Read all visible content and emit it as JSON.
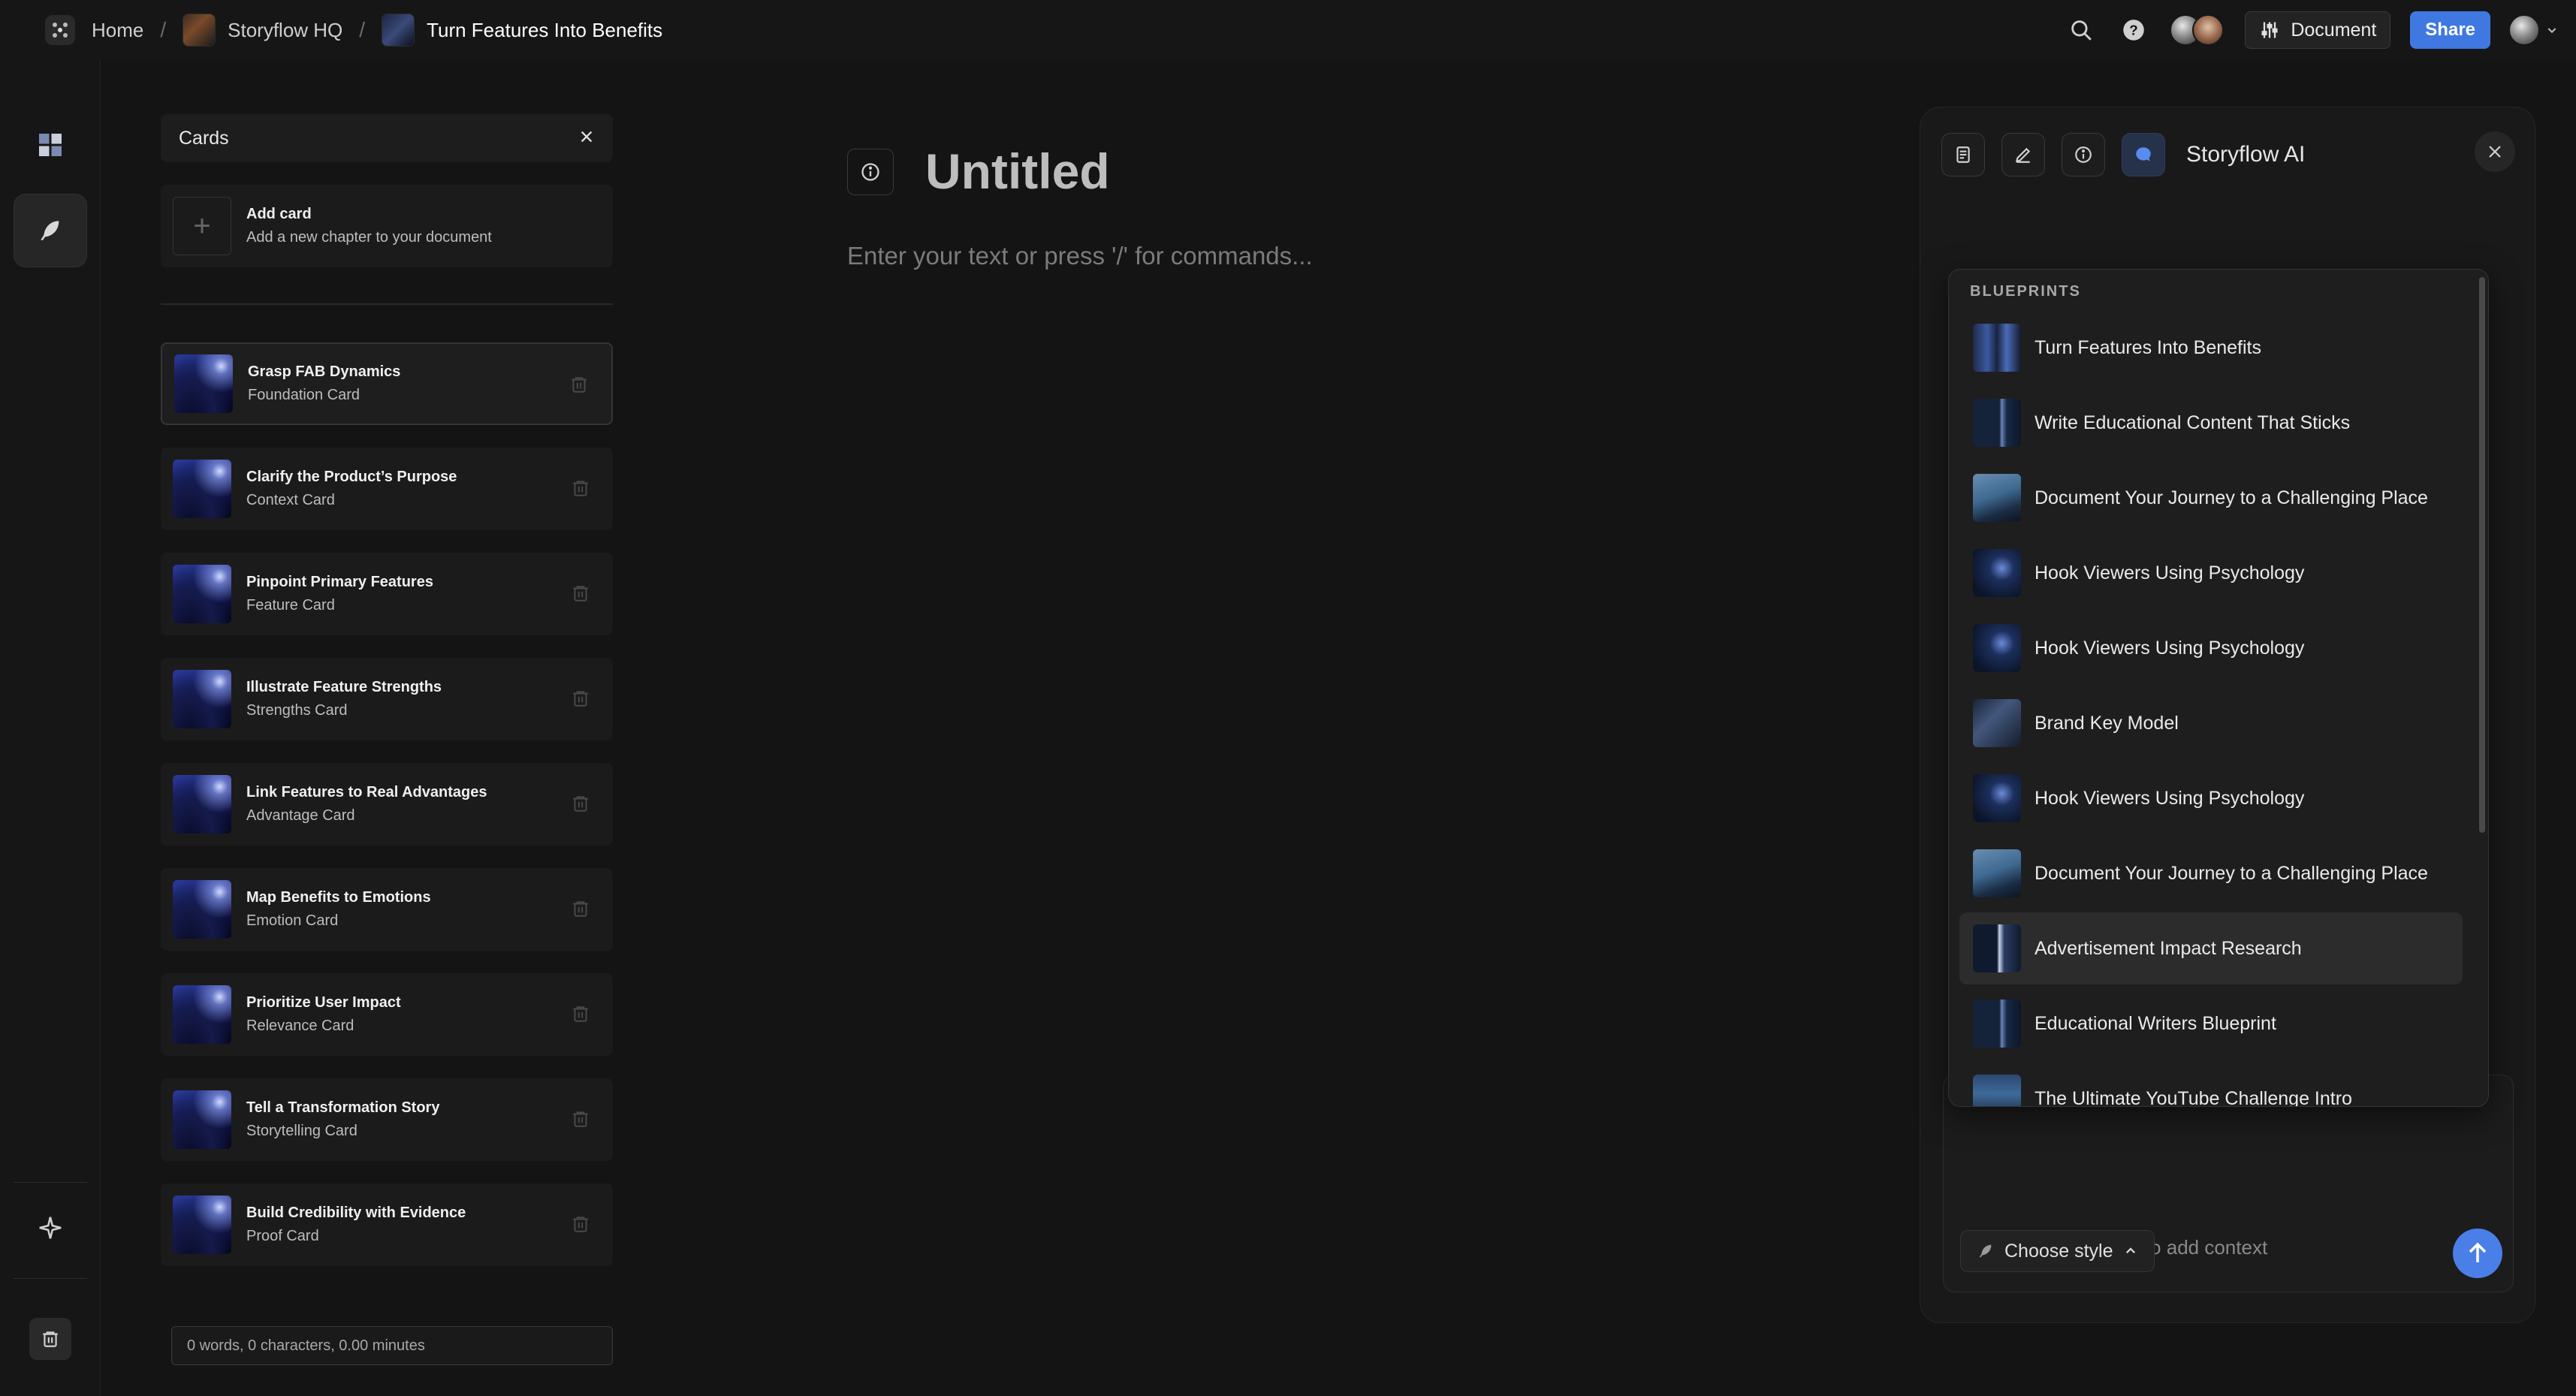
{
  "breadcrumbs": [
    {
      "label": "Home"
    },
    {
      "label": "Storyflow HQ"
    },
    {
      "label": "Turn Features Into Benefits"
    }
  ],
  "topbar": {
    "document_label": "Document",
    "share_label": "Share",
    "accent_color": "#3f78e0"
  },
  "cards_panel": {
    "title": "Cards",
    "add_card": {
      "title": "Add card",
      "subtitle": "Add a new chapter to your document"
    },
    "cards": [
      {
        "title": "Grasp FAB Dynamics",
        "subtitle": "Foundation Card"
      },
      {
        "title": "Clarify the Product’s Purpose",
        "subtitle": "Context Card"
      },
      {
        "title": "Pinpoint Primary Features",
        "subtitle": "Feature Card"
      },
      {
        "title": "Illustrate Feature Strengths",
        "subtitle": "Strengths Card"
      },
      {
        "title": "Link Features to Real Advantages",
        "subtitle": "Advantage Card"
      },
      {
        "title": "Map Benefits to Emotions",
        "subtitle": "Emotion Card"
      },
      {
        "title": "Prioritize User Impact",
        "subtitle": "Relevance Card"
      },
      {
        "title": "Tell a Transformation Story",
        "subtitle": "Storytelling Card"
      },
      {
        "title": "Build Credibility with Evidence",
        "subtitle": "Proof Card"
      }
    ],
    "stats": "0 words, 0 characters, 0.00 minutes"
  },
  "editor": {
    "title": "Untitled",
    "placeholder": "Enter your text or press '/' for commands..."
  },
  "ai_panel": {
    "name": "Storyflow AI",
    "input_placeholder": "Ask Storyflow AI, '@' to add context",
    "style_label": "Choose style",
    "blueprints_heading": "BLUEPRINTS",
    "blueprints": [
      {
        "label": "Turn Features Into Benefits"
      },
      {
        "label": "Write Educational Content That Sticks"
      },
      {
        "label": "Document Your Journey to a Challenging Place"
      },
      {
        "label": "Hook Viewers Using Psychology"
      },
      {
        "label": "Hook Viewers Using Psychology"
      },
      {
        "label": "Brand Key Model"
      },
      {
        "label": "Hook Viewers Using Psychology"
      },
      {
        "label": "Document Your Journey to a Challenging Place"
      },
      {
        "label": "Advertisement Impact Research"
      },
      {
        "label": "Educational Writers Blueprint"
      },
      {
        "label": "The Ultimate YouTube Challenge Intro"
      }
    ]
  }
}
